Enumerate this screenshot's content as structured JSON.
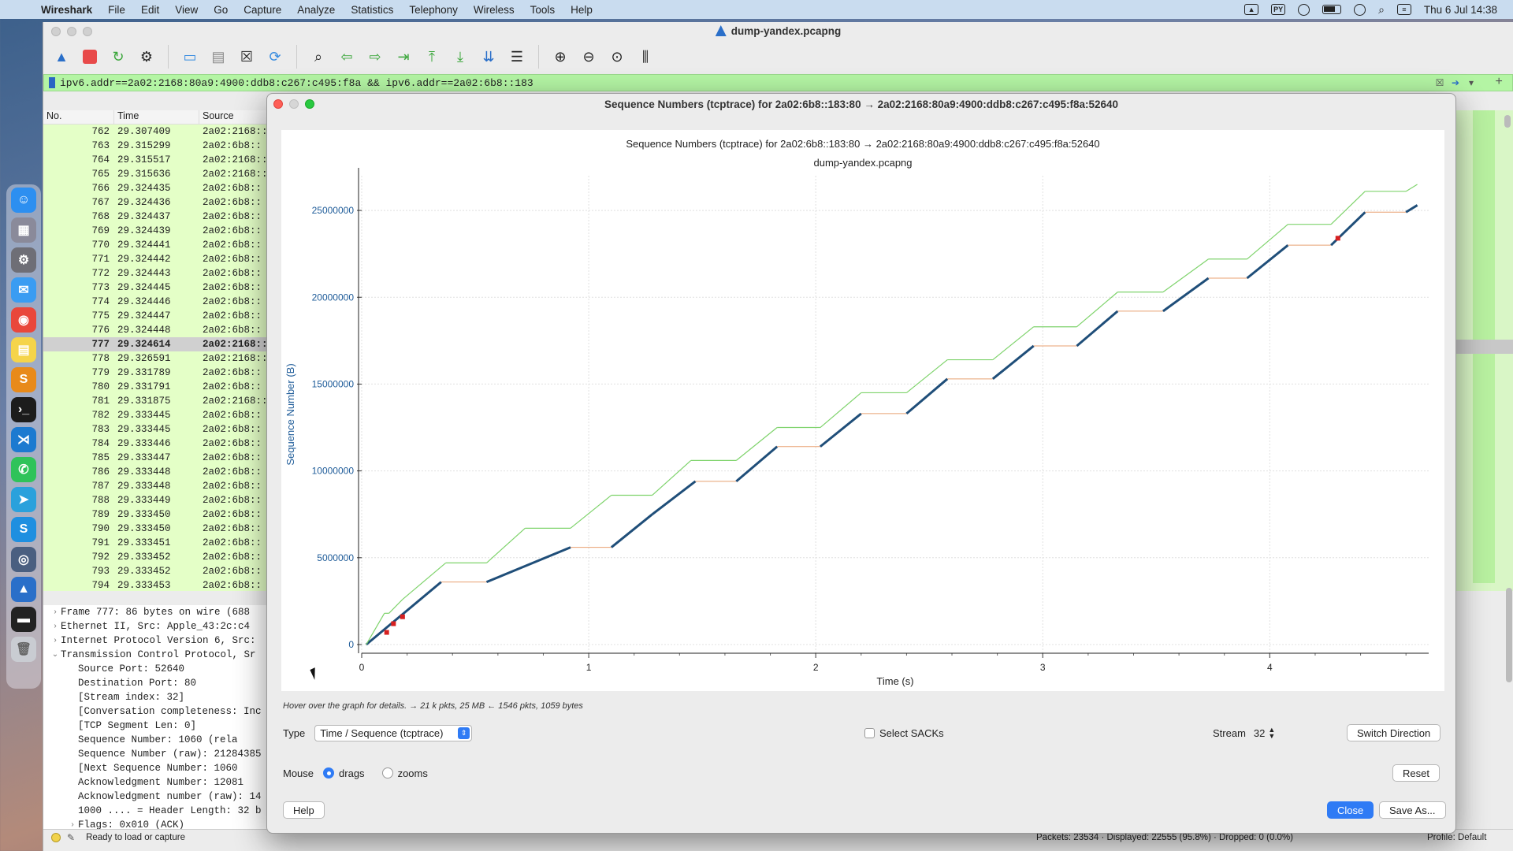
{
  "menubar": {
    "app": "Wireshark",
    "items": [
      "File",
      "Edit",
      "View",
      "Go",
      "Capture",
      "Analyze",
      "Statistics",
      "Telephony",
      "Wireless",
      "Tools",
      "Help"
    ],
    "py_badge": "PY",
    "clock": "Thu 6 Jul  14:38"
  },
  "window": {
    "title": "dump-yandex.pcapng",
    "filter": "ipv6.addr==2a02:2168:80a9:4900:ddb8:c267:c495:f8a && ipv6.addr==2a02:6b8::183"
  },
  "packet_list": {
    "headers": [
      "No.",
      "Time",
      "Source"
    ],
    "rows": [
      {
        "no": "762",
        "time": "29.307409",
        "src": "2a02:2168::"
      },
      {
        "no": "763",
        "time": "29.315299",
        "src": "2a02:6b8::"
      },
      {
        "no": "764",
        "time": "29.315517",
        "src": "2a02:2168::"
      },
      {
        "no": "765",
        "time": "29.315636",
        "src": "2a02:2168::"
      },
      {
        "no": "766",
        "time": "29.324435",
        "src": "2a02:6b8::"
      },
      {
        "no": "767",
        "time": "29.324436",
        "src": "2a02:6b8::"
      },
      {
        "no": "768",
        "time": "29.324437",
        "src": "2a02:6b8::"
      },
      {
        "no": "769",
        "time": "29.324439",
        "src": "2a02:6b8::"
      },
      {
        "no": "770",
        "time": "29.324441",
        "src": "2a02:6b8::"
      },
      {
        "no": "771",
        "time": "29.324442",
        "src": "2a02:6b8::"
      },
      {
        "no": "772",
        "time": "29.324443",
        "src": "2a02:6b8::"
      },
      {
        "no": "773",
        "time": "29.324445",
        "src": "2a02:6b8::"
      },
      {
        "no": "774",
        "time": "29.324446",
        "src": "2a02:6b8::"
      },
      {
        "no": "775",
        "time": "29.324447",
        "src": "2a02:6b8::"
      },
      {
        "no": "776",
        "time": "29.324448",
        "src": "2a02:6b8::"
      },
      {
        "no": "777",
        "time": "29.324614",
        "src": "2a02:2168::",
        "selected": true
      },
      {
        "no": "778",
        "time": "29.326591",
        "src": "2a02:2168::"
      },
      {
        "no": "779",
        "time": "29.331789",
        "src": "2a02:6b8::"
      },
      {
        "no": "780",
        "time": "29.331791",
        "src": "2a02:6b8::"
      },
      {
        "no": "781",
        "time": "29.331875",
        "src": "2a02:2168::"
      },
      {
        "no": "782",
        "time": "29.333445",
        "src": "2a02:6b8::"
      },
      {
        "no": "783",
        "time": "29.333445",
        "src": "2a02:6b8::"
      },
      {
        "no": "784",
        "time": "29.333446",
        "src": "2a02:6b8::"
      },
      {
        "no": "785",
        "time": "29.333447",
        "src": "2a02:6b8::"
      },
      {
        "no": "786",
        "time": "29.333448",
        "src": "2a02:6b8::"
      },
      {
        "no": "787",
        "time": "29.333448",
        "src": "2a02:6b8::"
      },
      {
        "no": "788",
        "time": "29.333449",
        "src": "2a02:6b8::"
      },
      {
        "no": "789",
        "time": "29.333450",
        "src": "2a02:6b8::"
      },
      {
        "no": "790",
        "time": "29.333450",
        "src": "2a02:6b8::"
      },
      {
        "no": "791",
        "time": "29.333451",
        "src": "2a02:6b8::"
      },
      {
        "no": "792",
        "time": "29.333452",
        "src": "2a02:6b8::"
      },
      {
        "no": "793",
        "time": "29.333452",
        "src": "2a02:6b8::"
      },
      {
        "no": "794",
        "time": "29.333453",
        "src": "2a02:6b8::"
      }
    ]
  },
  "details": {
    "rows": [
      {
        "arrow": "›",
        "indent": 0,
        "text": "Frame 777: 86 bytes on wire (688"
      },
      {
        "arrow": "›",
        "indent": 0,
        "text": "Ethernet II, Src: Apple_43:2c:c4"
      },
      {
        "arrow": "›",
        "indent": 0,
        "text": "Internet Protocol Version 6, Src:"
      },
      {
        "arrow": "⌄",
        "indent": 0,
        "text": "Transmission Control Protocol, Sr"
      },
      {
        "arrow": "",
        "indent": 1,
        "text": "Source Port: 52640"
      },
      {
        "arrow": "",
        "indent": 1,
        "text": "Destination Port: 80"
      },
      {
        "arrow": "",
        "indent": 1,
        "text": "[Stream index: 32]"
      },
      {
        "arrow": "",
        "indent": 1,
        "text": "[Conversation completeness: Inc"
      },
      {
        "arrow": "",
        "indent": 1,
        "text": "[TCP Segment Len: 0]"
      },
      {
        "arrow": "",
        "indent": 1,
        "text": "Sequence Number: 1060    (rela"
      },
      {
        "arrow": "",
        "indent": 1,
        "text": "Sequence Number (raw): 21284385"
      },
      {
        "arrow": "",
        "indent": 1,
        "text": "[Next Sequence Number: 1060"
      },
      {
        "arrow": "",
        "indent": 1,
        "text": "Acknowledgment Number: 12081"
      },
      {
        "arrow": "",
        "indent": 1,
        "text": "Acknowledgment number (raw): 14"
      },
      {
        "arrow": "",
        "indent": 1,
        "text": "1000 .... = Header Length: 32 b"
      },
      {
        "arrow": "›",
        "indent": 1,
        "text": "Flags: 0x010 (ACK)"
      },
      {
        "arrow": "",
        "indent": 1,
        "text": "Window: 1878"
      }
    ]
  },
  "status": {
    "ready": "Ready to load or capture",
    "packets": "Packets: 23534 · Displayed: 22555 (95.8%) · Dropped: 0 (0.0%)",
    "profile": "Profile: Default"
  },
  "dialog": {
    "title": "Sequence Numbers (tcptrace) for 2a02:6b8::183:80 → 2a02:2168:80a9:4900:ddb8:c267:c495:f8a:52640",
    "hover_hint": "Hover over the graph for details. → 21 k pkts, 25 MB ← 1546 pkts, 1059 bytes",
    "type_label": "Type",
    "type_value": "Time / Sequence (tcptrace)",
    "sack_label": "Select SACKs",
    "stream_label": "Stream",
    "stream_value": "32",
    "switch_direction": "Switch Direction",
    "mouse_label": "Mouse",
    "mouse_drags": "drags",
    "mouse_zooms": "zooms",
    "reset": "Reset",
    "help": "Help",
    "close": "Close",
    "save_as": "Save As..."
  },
  "chart_data": {
    "type": "line",
    "title": "Sequence Numbers (tcptrace) for 2a02:6b8::183:80 → 2a02:2168:80a9:4900:ddb8:c267:c495:f8a:52640",
    "subtitle": "dump-yandex.pcapng",
    "xlabel": "Time (s)",
    "ylabel": "Sequence Number (B)",
    "xlim": [
      0,
      4.7
    ],
    "ylim": [
      -500000,
      27000000
    ],
    "x_ticks": [
      "0",
      "1",
      "2",
      "3",
      "4"
    ],
    "y_ticks": [
      "0",
      "5000000",
      "10000000",
      "15000000",
      "20000000",
      "25000000"
    ],
    "grid": true,
    "colors": {
      "sequence": "#1f4e79",
      "window": "#7ed36b",
      "ack": "#e8a070",
      "sack": "#d62020",
      "axis_text": "#1f5c99"
    },
    "series": [
      {
        "name": "",
        "role": "sequence",
        "points": [
          [
            0.02,
            0
          ],
          [
            0.35,
            3600000
          ],
          [
            0.55,
            3600000
          ],
          [
            0.92,
            5600000
          ],
          [
            1.1,
            5600000
          ],
          [
            1.28,
            7500000
          ],
          [
            1.47,
            9400000
          ],
          [
            1.65,
            9400000
          ],
          [
            1.83,
            11400000
          ],
          [
            2.02,
            11400000
          ],
          [
            2.2,
            13300000
          ],
          [
            2.4,
            13300000
          ],
          [
            2.58,
            15300000
          ],
          [
            2.78,
            15300000
          ],
          [
            2.96,
            17200000
          ],
          [
            3.15,
            17200000
          ],
          [
            3.33,
            19200000
          ],
          [
            3.53,
            19200000
          ],
          [
            3.73,
            21100000
          ],
          [
            3.9,
            21100000
          ],
          [
            4.08,
            23000000
          ],
          [
            4.27,
            23000000
          ],
          [
            4.42,
            24900000
          ],
          [
            4.6,
            24900000
          ],
          [
            4.65,
            25300000
          ]
        ]
      },
      {
        "name": "",
        "role": "window",
        "points": [
          [
            0.02,
            0
          ],
          [
            0.1,
            1800000
          ],
          [
            0.12,
            1800000
          ],
          [
            0.18,
            2600000
          ],
          [
            0.37,
            4700000
          ],
          [
            0.55,
            4700000
          ],
          [
            0.72,
            6700000
          ],
          [
            0.92,
            6700000
          ],
          [
            1.1,
            8600000
          ],
          [
            1.28,
            8600000
          ],
          [
            1.45,
            10600000
          ],
          [
            1.65,
            10600000
          ],
          [
            1.83,
            12500000
          ],
          [
            2.02,
            12500000
          ],
          [
            2.2,
            14500000
          ],
          [
            2.4,
            14500000
          ],
          [
            2.58,
            16400000
          ],
          [
            2.78,
            16400000
          ],
          [
            2.96,
            18300000
          ],
          [
            3.15,
            18300000
          ],
          [
            3.33,
            20300000
          ],
          [
            3.53,
            20300000
          ],
          [
            3.73,
            22200000
          ],
          [
            3.9,
            22200000
          ],
          [
            4.08,
            24200000
          ],
          [
            4.27,
            24200000
          ],
          [
            4.42,
            26100000
          ],
          [
            4.6,
            26100000
          ],
          [
            4.65,
            26500000
          ]
        ]
      },
      {
        "name": "",
        "role": "sack",
        "points": [
          [
            0.11,
            700000
          ],
          [
            0.14,
            1200000
          ],
          [
            0.18,
            1600000
          ],
          [
            4.3,
            23400000
          ]
        ]
      }
    ]
  }
}
